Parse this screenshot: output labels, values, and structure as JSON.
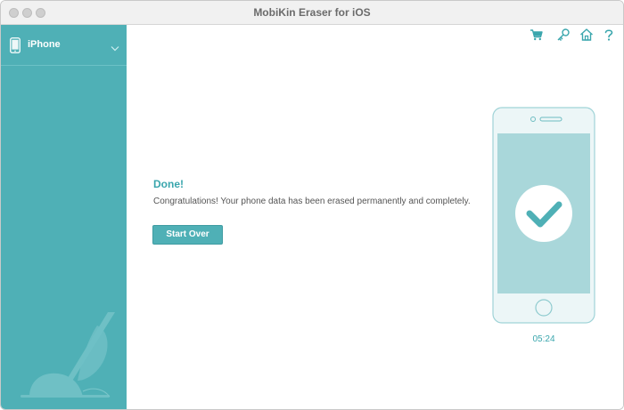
{
  "window": {
    "title": "MobiKin Eraser for iOS"
  },
  "sidebar": {
    "device_label": "iPhone",
    "accent_color": "#4fb0b6"
  },
  "toolbar": {
    "icons": [
      "cart-icon",
      "key-icon",
      "home-icon",
      "help-icon"
    ]
  },
  "result": {
    "title": "Done!",
    "message": "Congratulations! Your phone data has been erased permanently and completely.",
    "button_label": "Start Over",
    "timer": "05:24"
  },
  "colors": {
    "accent": "#4fb0b6",
    "accent_text": "#3aa6ad",
    "phone_screen": "#a9d7da",
    "phone_body": "#ecf6f7"
  }
}
